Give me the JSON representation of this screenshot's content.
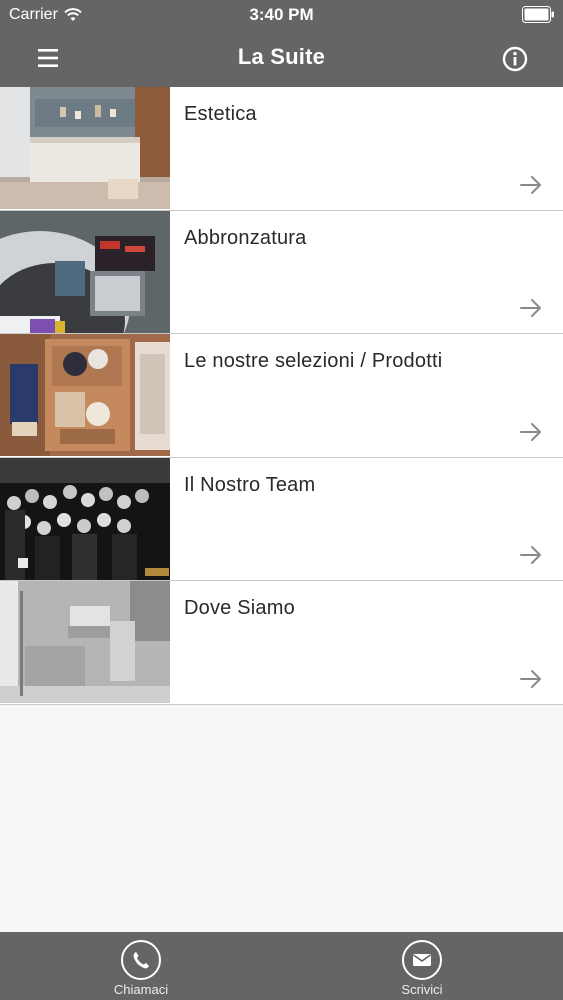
{
  "status_bar": {
    "carrier": "Carrier",
    "time": "3:40 PM",
    "wifi_icon": "wifi-icon",
    "battery_icon": "battery-icon"
  },
  "nav_bar": {
    "title": "La Suite",
    "menu_icon": "hamburger-menu-icon",
    "info_icon": "info-icon"
  },
  "list": {
    "items": [
      {
        "label": "Estetica",
        "thumbnail": "salon-reception-photo"
      },
      {
        "label": "Abbronzatura",
        "thumbnail": "tanning-bed-photo"
      },
      {
        "label": "Le nostre selezioni / Prodotti",
        "thumbnail": "products-box-photo"
      },
      {
        "label": "Il Nostro Team",
        "thumbnail": "team-group-photo"
      },
      {
        "label": "Dove Siamo",
        "thumbnail": "storefront-photo"
      }
    ],
    "arrow_icon": "arrow-right-icon"
  },
  "tab_bar": {
    "call": {
      "label": "Chiamaci",
      "icon": "phone-icon"
    },
    "write": {
      "label": "Scrivici",
      "icon": "mail-icon"
    }
  },
  "colors": {
    "bar": "#666566",
    "list_bg": "#ffffff",
    "page_bg": "#f7f7f7",
    "separator": "#c8c8c8",
    "arrow": "#8a8a8a"
  }
}
